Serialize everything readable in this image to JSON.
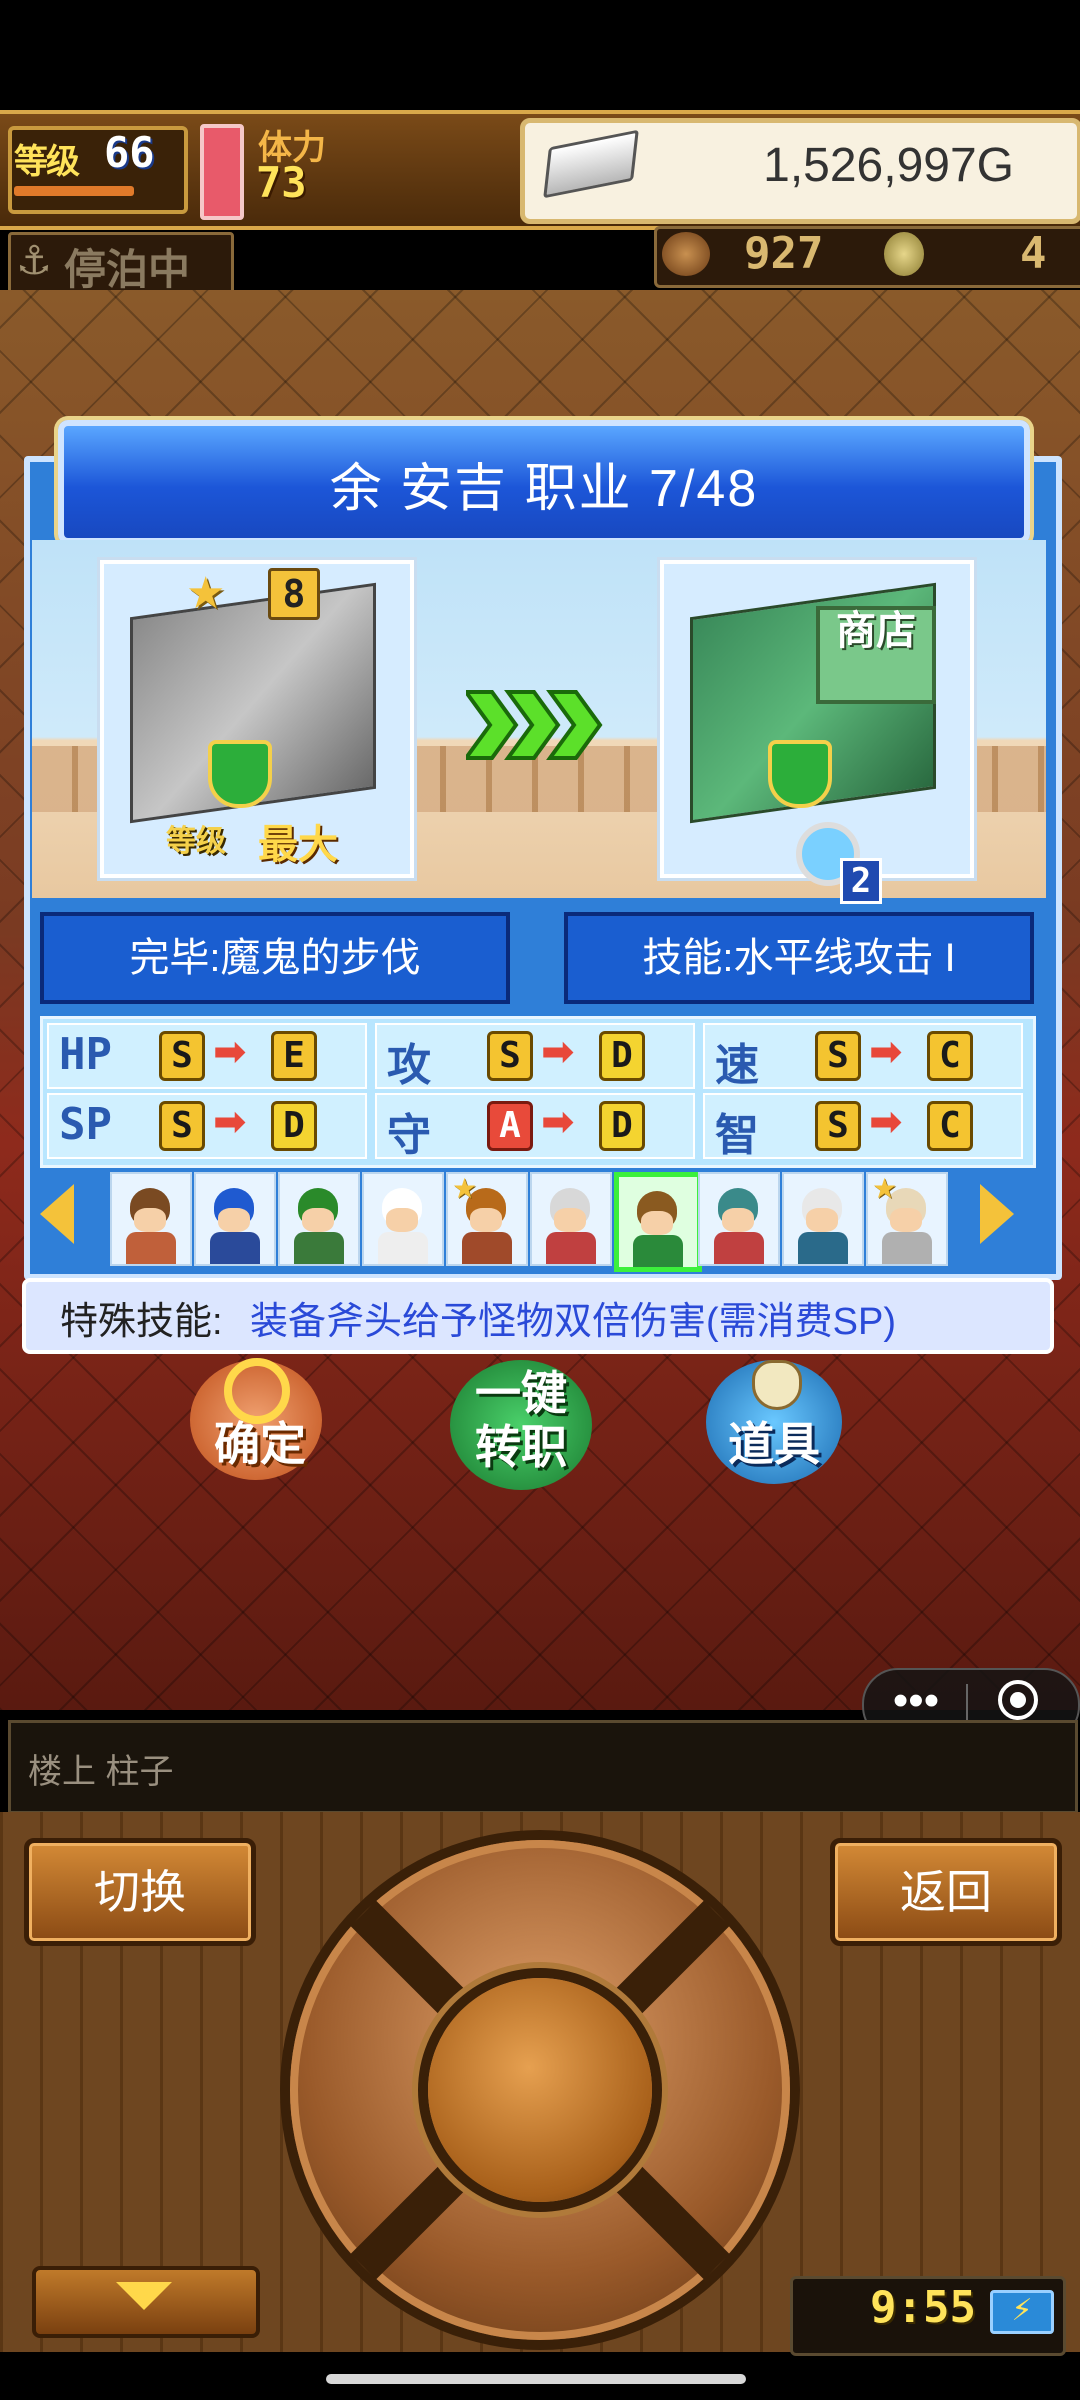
{
  "hud": {
    "level_label": "等级",
    "level": "66",
    "stamina_label": "体力",
    "stamina": "73",
    "gold": "1,526,997G",
    "dock_status": "停泊中",
    "resource_1": "927",
    "resource_2": "4"
  },
  "dialog": {
    "title": "余 安吉  职业 7/48",
    "card_left": {
      "star_count": "8",
      "level_tag": "等级",
      "max_tag": "最大"
    },
    "card_right": {
      "shop_sign": "商店",
      "badge": "2"
    },
    "info_left": "完毕:魔鬼的步伐",
    "info_right": "技能:水平线攻击 I",
    "stats": [
      {
        "label": "HP",
        "from": "S",
        "to": "E"
      },
      {
        "label": "攻",
        "from": "S",
        "to": "D"
      },
      {
        "label": "速",
        "from": "S",
        "to": "C"
      },
      {
        "label": "SP",
        "from": "S",
        "to": "D"
      },
      {
        "label": "守",
        "from": "A",
        "to": "D"
      },
      {
        "label": "智",
        "from": "S",
        "to": "C"
      }
    ],
    "characters": [
      {
        "name": "char-1",
        "hair": "#7a4a22",
        "body": "#c0603a",
        "star": false,
        "selected": false
      },
      {
        "name": "char-2",
        "hair": "#1f5ad0",
        "body": "#2a4a9a",
        "star": false,
        "selected": false
      },
      {
        "name": "char-3",
        "hair": "#2a8a2a",
        "body": "#3a7a3a",
        "star": false,
        "selected": false
      },
      {
        "name": "char-4",
        "hair": "#ffffff",
        "body": "#eeeeee",
        "star": false,
        "selected": false
      },
      {
        "name": "char-5",
        "hair": "#b86a1a",
        "body": "#a04a2a",
        "star": true,
        "selected": false
      },
      {
        "name": "char-6",
        "hair": "#d8d8d8",
        "body": "#c04040",
        "star": false,
        "selected": false
      },
      {
        "name": "char-7",
        "hair": "#8a5a20",
        "body": "#2a8a3a",
        "star": false,
        "selected": true
      },
      {
        "name": "char-8",
        "hair": "#3a8a8a",
        "body": "#c04040",
        "star": false,
        "selected": false
      },
      {
        "name": "char-9",
        "hair": "#e8e8e8",
        "body": "#2a6a8a",
        "star": false,
        "selected": false
      },
      {
        "name": "char-10",
        "hair": "#e8d8b8",
        "body": "#b0b0b0",
        "star": true,
        "selected": false
      }
    ],
    "special_label": "特殊技能:",
    "special_text": "装备斧头给予怪物双倍伤害(需消费SP)"
  },
  "actions": {
    "confirm": "确定",
    "switch_line1": "一键",
    "switch_line2": "转职",
    "item": "道具"
  },
  "message": "楼上 柱子",
  "controls": {
    "switch": "切换",
    "back": "返回",
    "clock": "9:55",
    "battery_icon": "⚡"
  },
  "capsule": {
    "more": "•••"
  },
  "colors": {
    "dialog_blue": "#2f7fd8",
    "title_blue": "#1c56d8",
    "gold_text": "#ffe35a",
    "selected_green": "#3cf03c"
  }
}
